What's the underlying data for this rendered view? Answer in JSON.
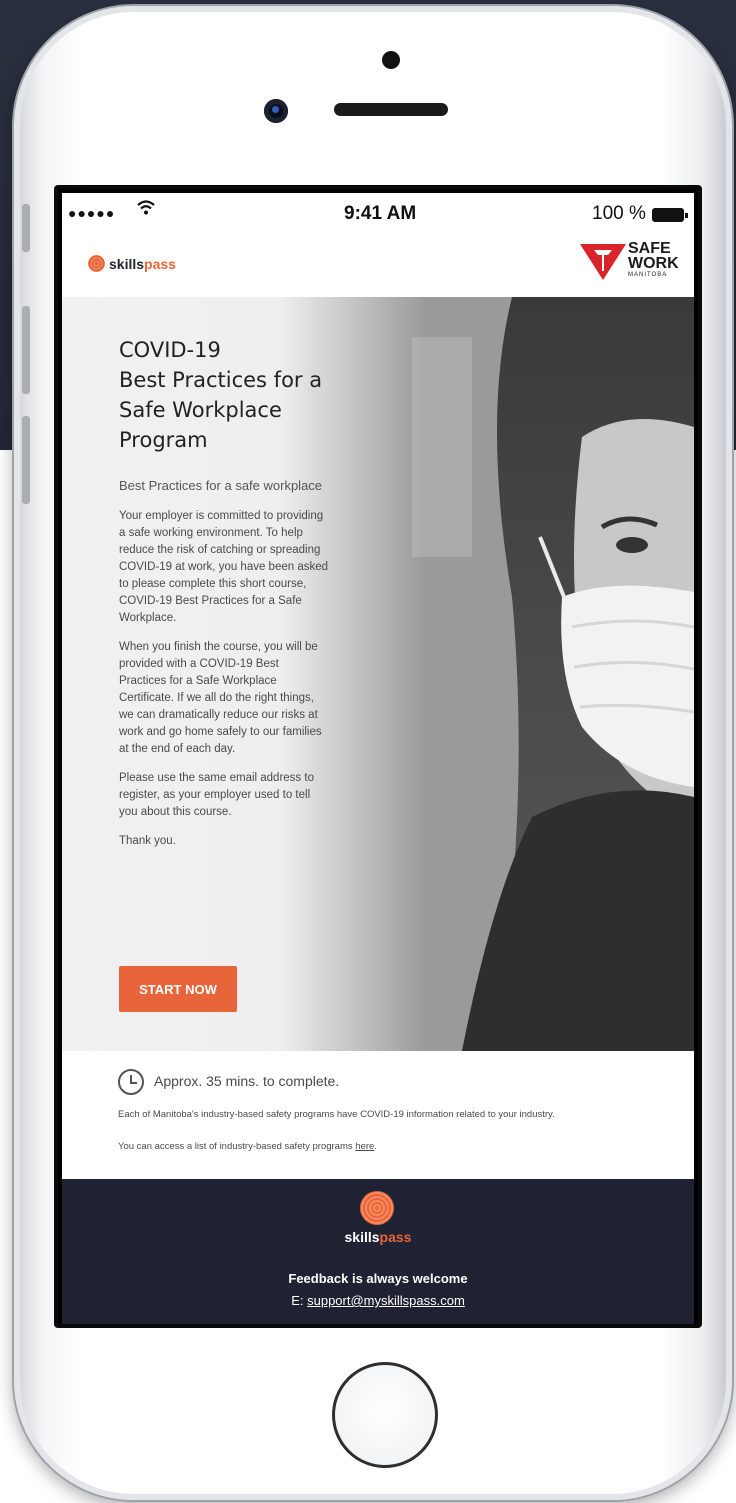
{
  "status_bar": {
    "signal": "●●●●●",
    "time": "9:41 AM",
    "battery": "100 %"
  },
  "header": {
    "logo_left": {
      "part1": "skills",
      "part2": "pass"
    },
    "logo_right": {
      "line1": "SAFE",
      "line2": "WORK",
      "line3": "MANITOBA"
    }
  },
  "hero": {
    "title_lines": [
      "COVID-19",
      "Best Practices for a",
      "Safe Workplace",
      "Program"
    ],
    "subtitle": "Best Practices for a safe workplace",
    "paragraphs": [
      "Your employer is committed to providing a safe working environment.  To help reduce the risk of catching or spreading COVID-19 at work, you have been asked to please complete this short course, COVID-19 Best Practices for a Safe Workplace.",
      "When you finish the course, you will be provided with a COVID-19 Best Practices for a Safe Workplace Certificate. If we all do the right things, we can dramatically reduce our risks at work and go home safely to our families at the end of each day.",
      "Please use the same email address to register, as your employer used to tell you about this course.",
      "Thank you."
    ],
    "cta": "START NOW"
  },
  "info": {
    "duration": "Approx. 35 mins. to complete.",
    "line1": "Each of Manitoba's industry-based safety programs have COVID-19 information related to your industry.",
    "line2_prefix": "You can access a list of industry-based safety programs ",
    "line2_link": "here",
    "line2_suffix": "."
  },
  "footer": {
    "logo": {
      "part1": "skills",
      "part2": "pass"
    },
    "feedback": "Feedback is always welcome",
    "email_prefix": "E: ",
    "email": "support@myskillspass.com"
  },
  "colors": {
    "accent": "#e8643a",
    "footer_bg": "#1f2233",
    "swm_red": "#d9242b"
  },
  "icons": {
    "wifi": "wifi-icon",
    "battery": "battery-icon",
    "clock": "clock-icon",
    "fingerprint": "fingerprint-logo-icon"
  }
}
